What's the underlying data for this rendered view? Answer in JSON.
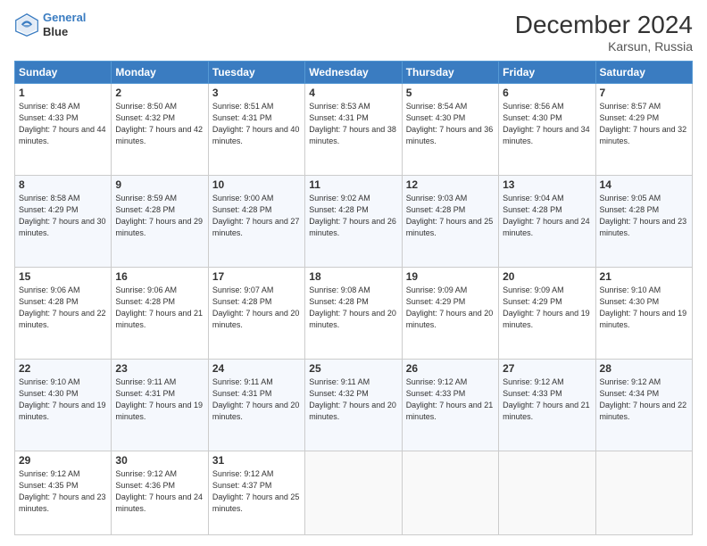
{
  "header": {
    "logo_line1": "General",
    "logo_line2": "Blue",
    "month_title": "December 2024",
    "location": "Karsun, Russia"
  },
  "weekdays": [
    "Sunday",
    "Monday",
    "Tuesday",
    "Wednesday",
    "Thursday",
    "Friday",
    "Saturday"
  ],
  "weeks": [
    [
      {
        "day": "1",
        "sunrise": "8:48 AM",
        "sunset": "4:33 PM",
        "daylight": "7 hours and 44 minutes."
      },
      {
        "day": "2",
        "sunrise": "8:50 AM",
        "sunset": "4:32 PM",
        "daylight": "7 hours and 42 minutes."
      },
      {
        "day": "3",
        "sunrise": "8:51 AM",
        "sunset": "4:31 PM",
        "daylight": "7 hours and 40 minutes."
      },
      {
        "day": "4",
        "sunrise": "8:53 AM",
        "sunset": "4:31 PM",
        "daylight": "7 hours and 38 minutes."
      },
      {
        "day": "5",
        "sunrise": "8:54 AM",
        "sunset": "4:30 PM",
        "daylight": "7 hours and 36 minutes."
      },
      {
        "day": "6",
        "sunrise": "8:56 AM",
        "sunset": "4:30 PM",
        "daylight": "7 hours and 34 minutes."
      },
      {
        "day": "7",
        "sunrise": "8:57 AM",
        "sunset": "4:29 PM",
        "daylight": "7 hours and 32 minutes."
      }
    ],
    [
      {
        "day": "8",
        "sunrise": "8:58 AM",
        "sunset": "4:29 PM",
        "daylight": "7 hours and 30 minutes."
      },
      {
        "day": "9",
        "sunrise": "8:59 AM",
        "sunset": "4:28 PM",
        "daylight": "7 hours and 29 minutes."
      },
      {
        "day": "10",
        "sunrise": "9:00 AM",
        "sunset": "4:28 PM",
        "daylight": "7 hours and 27 minutes."
      },
      {
        "day": "11",
        "sunrise": "9:02 AM",
        "sunset": "4:28 PM",
        "daylight": "7 hours and 26 minutes."
      },
      {
        "day": "12",
        "sunrise": "9:03 AM",
        "sunset": "4:28 PM",
        "daylight": "7 hours and 25 minutes."
      },
      {
        "day": "13",
        "sunrise": "9:04 AM",
        "sunset": "4:28 PM",
        "daylight": "7 hours and 24 minutes."
      },
      {
        "day": "14",
        "sunrise": "9:05 AM",
        "sunset": "4:28 PM",
        "daylight": "7 hours and 23 minutes."
      }
    ],
    [
      {
        "day": "15",
        "sunrise": "9:06 AM",
        "sunset": "4:28 PM",
        "daylight": "7 hours and 22 minutes."
      },
      {
        "day": "16",
        "sunrise": "9:06 AM",
        "sunset": "4:28 PM",
        "daylight": "7 hours and 21 minutes."
      },
      {
        "day": "17",
        "sunrise": "9:07 AM",
        "sunset": "4:28 PM",
        "daylight": "7 hours and 20 minutes."
      },
      {
        "day": "18",
        "sunrise": "9:08 AM",
        "sunset": "4:28 PM",
        "daylight": "7 hours and 20 minutes."
      },
      {
        "day": "19",
        "sunrise": "9:09 AM",
        "sunset": "4:29 PM",
        "daylight": "7 hours and 20 minutes."
      },
      {
        "day": "20",
        "sunrise": "9:09 AM",
        "sunset": "4:29 PM",
        "daylight": "7 hours and 19 minutes."
      },
      {
        "day": "21",
        "sunrise": "9:10 AM",
        "sunset": "4:30 PM",
        "daylight": "7 hours and 19 minutes."
      }
    ],
    [
      {
        "day": "22",
        "sunrise": "9:10 AM",
        "sunset": "4:30 PM",
        "daylight": "7 hours and 19 minutes."
      },
      {
        "day": "23",
        "sunrise": "9:11 AM",
        "sunset": "4:31 PM",
        "daylight": "7 hours and 19 minutes."
      },
      {
        "day": "24",
        "sunrise": "9:11 AM",
        "sunset": "4:31 PM",
        "daylight": "7 hours and 20 minutes."
      },
      {
        "day": "25",
        "sunrise": "9:11 AM",
        "sunset": "4:32 PM",
        "daylight": "7 hours and 20 minutes."
      },
      {
        "day": "26",
        "sunrise": "9:12 AM",
        "sunset": "4:33 PM",
        "daylight": "7 hours and 21 minutes."
      },
      {
        "day": "27",
        "sunrise": "9:12 AM",
        "sunset": "4:33 PM",
        "daylight": "7 hours and 21 minutes."
      },
      {
        "day": "28",
        "sunrise": "9:12 AM",
        "sunset": "4:34 PM",
        "daylight": "7 hours and 22 minutes."
      }
    ],
    [
      {
        "day": "29",
        "sunrise": "9:12 AM",
        "sunset": "4:35 PM",
        "daylight": "7 hours and 23 minutes."
      },
      {
        "day": "30",
        "sunrise": "9:12 AM",
        "sunset": "4:36 PM",
        "daylight": "7 hours and 24 minutes."
      },
      {
        "day": "31",
        "sunrise": "9:12 AM",
        "sunset": "4:37 PM",
        "daylight": "7 hours and 25 minutes."
      },
      null,
      null,
      null,
      null
    ]
  ]
}
